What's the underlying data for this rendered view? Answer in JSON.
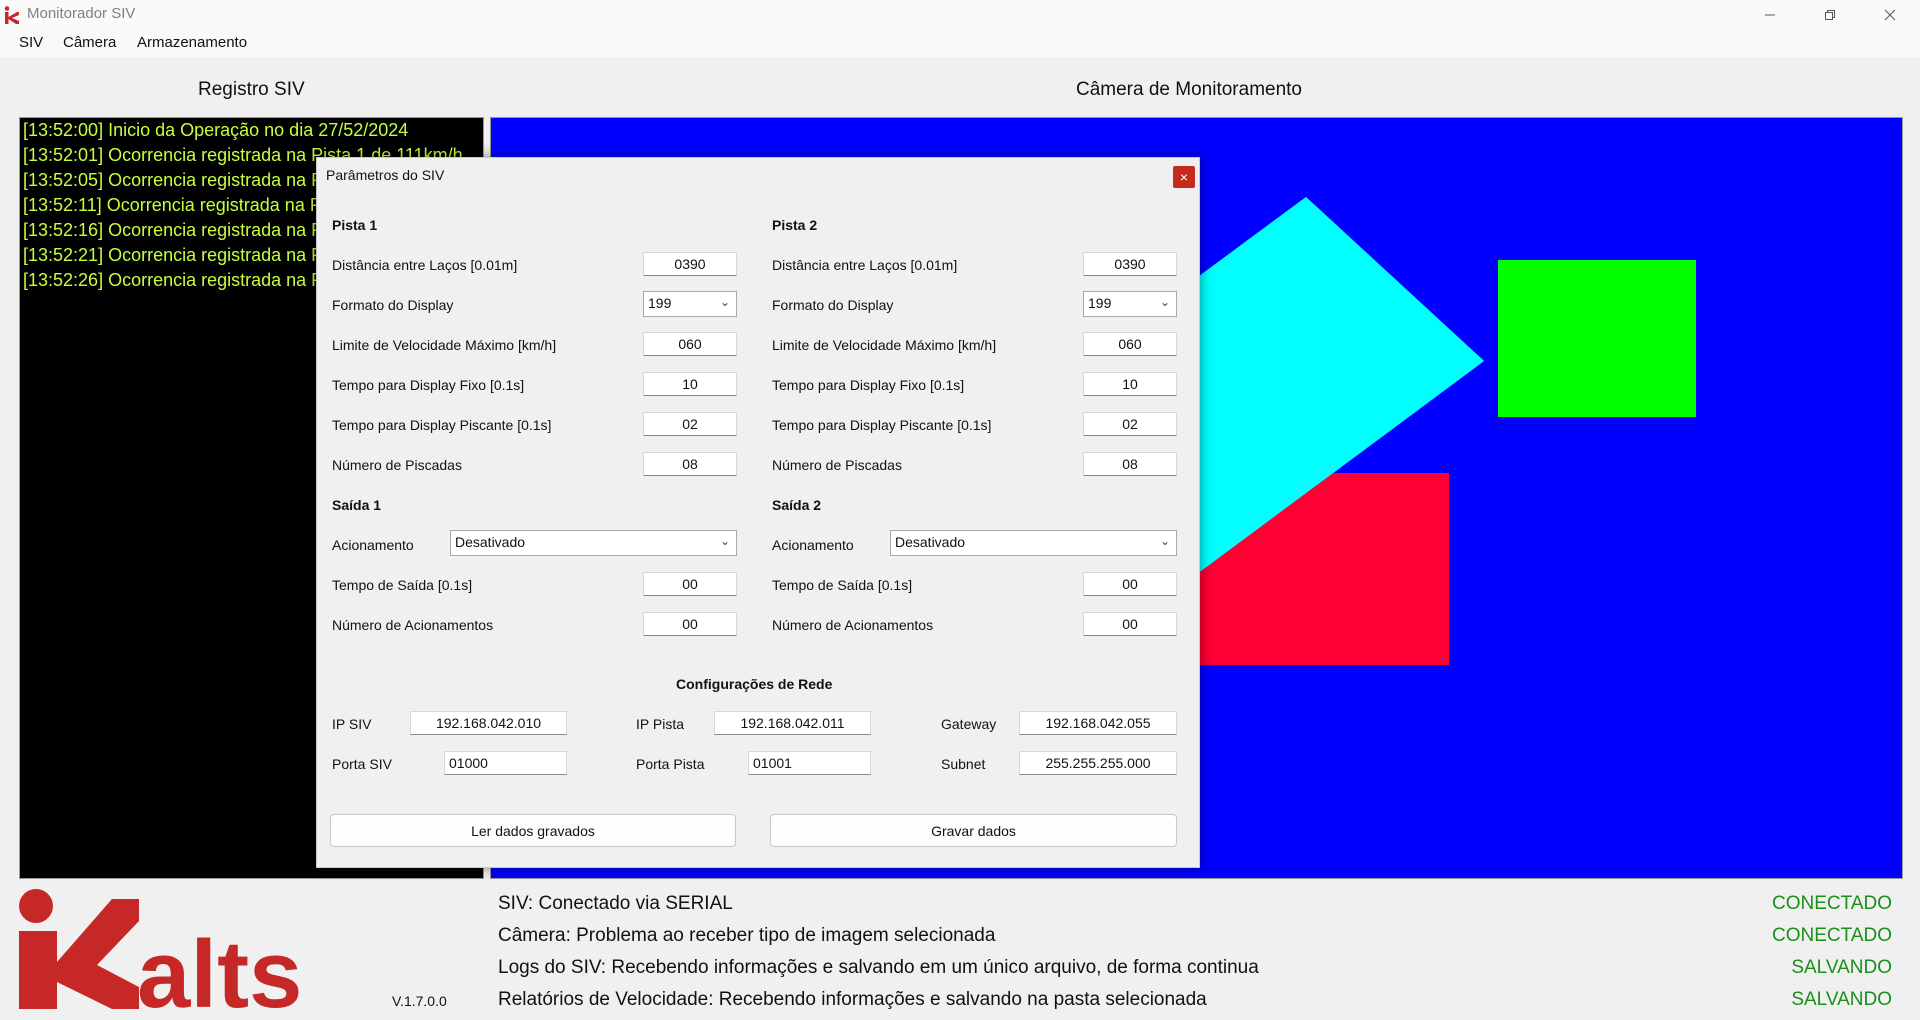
{
  "window": {
    "title": "Monitorador SIV",
    "minimize_icon": "minimize-icon",
    "restore_icon": "restore-icon",
    "close_icon": "close-icon"
  },
  "menu": {
    "items": [
      "SIV",
      "Câmera",
      "Armazenamento"
    ]
  },
  "log": {
    "title": "Registro SIV",
    "lines": [
      "[13:52:00] Inicio da Operação no dia 27/52/2024",
      "[13:52:01] Ocorrencia registrada na Pista 1 de 111km/h",
      "[13:52:05] Ocorrencia registrada na Pi",
      "[13:52:11] Ocorrencia registrada na Pi",
      "[13:52:16] Ocorrencia registrada na Pi",
      "[13:52:21] Ocorrencia registrada na Pi",
      "[13:52:26] Ocorrencia registrada na Pi"
    ]
  },
  "camera": {
    "title": "Câmera de Monitoramento",
    "background": "#0000ff",
    "shapes": [
      "#00ffff",
      "#00ff00",
      "#ff0033"
    ]
  },
  "dialog": {
    "title": "Parâmetros do SIV",
    "close_label": "×",
    "pista1": {
      "heading": "Pista 1",
      "rows": [
        {
          "label": "Distância entre Laços [0.01m]",
          "value": "0390"
        },
        {
          "label": "Formato do Display",
          "value": "199"
        },
        {
          "label": "Limite de Velocidade Máximo [km/h]",
          "value": "060"
        },
        {
          "label": "Tempo para Display Fixo [0.1s]",
          "value": "10"
        },
        {
          "label": "Tempo para Display Piscante [0.1s]",
          "value": "02"
        },
        {
          "label": "Número de Piscadas",
          "value": "08"
        }
      ]
    },
    "pista2": {
      "heading": "Pista 2",
      "rows": [
        {
          "label": "Distância entre Laços [0.01m]",
          "value": "0390"
        },
        {
          "label": "Formato do Display",
          "value": "199"
        },
        {
          "label": "Limite de Velocidade Máximo [km/h]",
          "value": "060"
        },
        {
          "label": "Tempo para Display Fixo [0.1s]",
          "value": "10"
        },
        {
          "label": "Tempo para Display Piscante [0.1s]",
          "value": "02"
        },
        {
          "label": "Número de Piscadas",
          "value": "08"
        }
      ]
    },
    "saida1": {
      "heading": "Saída 1",
      "acionamento_label": "Acionamento",
      "acionamento_value": "Desativado",
      "tempo_label": "Tempo de Saída [0.1s]",
      "tempo_value": "00",
      "numero_label": "Número de Acionamentos",
      "numero_value": "00"
    },
    "saida2": {
      "heading": "Saída 2",
      "acionamento_label": "Acionamento",
      "acionamento_value": "Desativado",
      "tempo_label": "Tempo de Saída [0.1s]",
      "tempo_value": "00",
      "numero_label": "Número de Acionamentos",
      "numero_value": "00"
    },
    "rede": {
      "heading": "Configurações de Rede",
      "ip_siv_label": "IP SIV",
      "ip_siv": "192.168.042.010",
      "porta_siv_label": "Porta SIV",
      "porta_siv": "01000",
      "ip_pista_label": "IP Pista",
      "ip_pista": "192.168.042.011",
      "porta_pista_label": "Porta Pista",
      "porta_pista": "01001",
      "gateway_label": "Gateway",
      "gateway": "192.168.042.055",
      "subnet_label": "Subnet",
      "subnet": "255.255.255.000"
    },
    "buttons": {
      "read": "Ler dados gravados",
      "write": "Gravar dados"
    }
  },
  "status": {
    "rows": [
      {
        "text": "SIV: Conectado via SERIAL",
        "value": "CONECTADO"
      },
      {
        "text": "Câmera: Problema ao receber tipo de imagem selecionada",
        "value": "CONECTADO"
      },
      {
        "text": "Logs do SIV: Recebendo informações e salvando em um único arquivo, de forma continua",
        "value": "SALVANDO"
      },
      {
        "text": "Relatórios de Velocidade: Recebendo informações e salvando na pasta selecionada",
        "value": "SALVANDO"
      }
    ]
  },
  "branding": {
    "logo_text": "Kalts",
    "version": "V.1.7.0.0",
    "color": "#c62828"
  }
}
